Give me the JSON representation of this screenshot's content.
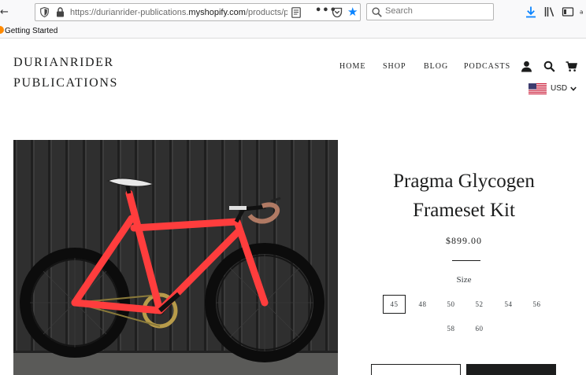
{
  "browser": {
    "url_prefix": "https://durianrider-publications.",
    "url_host": "myshopify.com",
    "url_suffix": "/products/pragma-glycogen-frameset-kit",
    "search_placeholder": "Search",
    "bookmarks": [
      {
        "label": "Getting Started"
      }
    ],
    "icons": [
      "back-icon",
      "tracking-shield-icon",
      "lock-icon",
      "reader-view-icon",
      "page-actions-icon",
      "pocket-icon",
      "bookmark-star-icon",
      "search-icon",
      "download-icon",
      "library-icon",
      "sidebar-icon",
      "amazon-icon"
    ],
    "accent_color": "#0a84ff"
  },
  "store": {
    "logo_line1": "DURIANRIDER",
    "logo_line2": "PUBLICATIONS",
    "nav": [
      {
        "label": "HOME"
      },
      {
        "label": "SHOP"
      },
      {
        "label": "BLOG"
      },
      {
        "label": "PODCASTS"
      }
    ],
    "header_icons": [
      "account-icon",
      "search-icon",
      "cart-icon"
    ],
    "currency": {
      "code": "USD",
      "flag": "us-flag-icon"
    }
  },
  "product": {
    "title": "Pragma Glycogen Frameset Kit",
    "price": "$899.00",
    "size_label": "Size",
    "sizes": [
      "45",
      "48",
      "50",
      "52",
      "54",
      "56",
      "58",
      "60"
    ],
    "selected_size": "45",
    "image": "red-road-bike-against-black-wall",
    "text_color": "#1c1d1d"
  }
}
